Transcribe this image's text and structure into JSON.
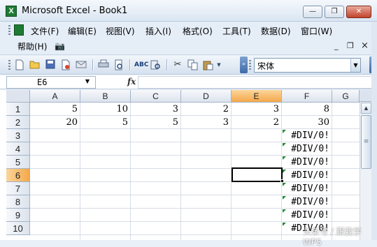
{
  "window": {
    "title": "Microsoft Excel - Book1",
    "buttons": {
      "minimize": "—",
      "restore": "❐",
      "close": "✕"
    }
  },
  "menu": {
    "items": [
      "文件(F)",
      "编辑(E)",
      "视图(V)",
      "插入(I)",
      "格式(O)",
      "工具(T)",
      "数据(D)",
      "窗口(W)",
      "帮助(H)"
    ],
    "doc_controls": {
      "minimize": "_",
      "restore": "❐",
      "close": "×"
    }
  },
  "toolbar": {
    "icons": [
      "new-icon",
      "open-icon",
      "save-icon",
      "permission-icon",
      "email-icon",
      "print-icon",
      "print-preview-icon",
      "spelling-icon",
      "research-icon",
      "cut-icon",
      "copy-icon",
      "paste-icon"
    ],
    "font_name": "宋体"
  },
  "formula_bar": {
    "name_box": "E6",
    "fx_label": "fx",
    "formula": ""
  },
  "sheet": {
    "columns": [
      "A",
      "B",
      "C",
      "D",
      "E",
      "F",
      "G"
    ],
    "rows": [
      "1",
      "2",
      "3",
      "4",
      "5",
      "6",
      "7",
      "8",
      "9",
      "10"
    ],
    "active_column": "E",
    "active_row": "6",
    "cells": {
      "A1": "5",
      "B1": "10",
      "C1": "3",
      "D1": "2",
      "E1": "3",
      "F1": "8",
      "A2": "20",
      "B2": "5",
      "C2": "5",
      "D2": "3",
      "E2": "2",
      "F2": "30",
      "F3": "#DIV/0!",
      "F4": "#DIV/0!",
      "F5": "#DIV/0!",
      "F6": "#DIV/0!",
      "F7": "#DIV/0!",
      "F8": "#DIV/0!",
      "F9": "#DIV/0!",
      "F10": "#DIV/0!"
    },
    "error_cells": [
      "F3",
      "F4",
      "F5",
      "F6",
      "F7",
      "F8",
      "F9",
      "F10"
    ]
  },
  "watermark": "头条号 / 跟我学WPS"
}
